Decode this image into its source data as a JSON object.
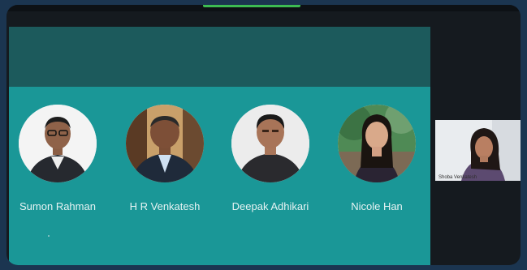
{
  "speakers": [
    {
      "name": "Sumon Rahman"
    },
    {
      "name": "H R Venkatesh"
    },
    {
      "name": "Deepak Adhikari"
    },
    {
      "name": "Nicole Han"
    }
  ],
  "participant_tile": {
    "name": "Shoba Venkatesh"
  },
  "colors": {
    "slide": "#1a9797",
    "header": "#1c5a5c",
    "window": "#151a1f",
    "indicator": "#3dbb52"
  }
}
